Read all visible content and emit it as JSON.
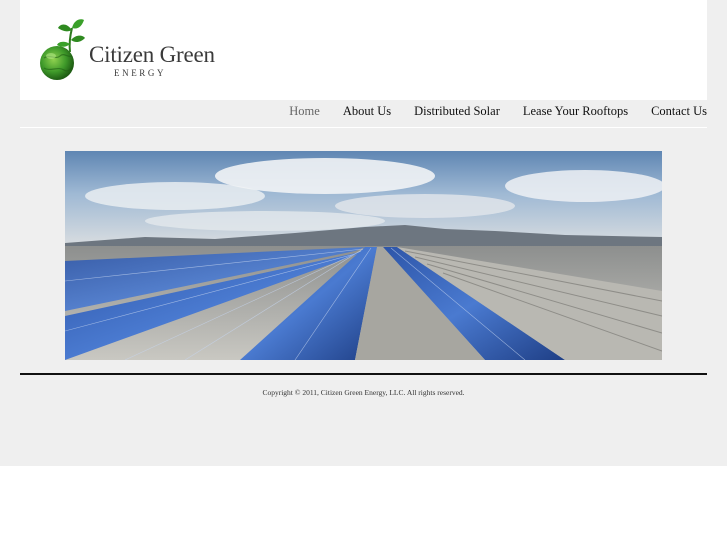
{
  "logo": {
    "name": "Citizen Green",
    "sub": "ENERGY"
  },
  "nav": {
    "items": [
      {
        "label": "Home",
        "active": true
      },
      {
        "label": "About Us",
        "active": false
      },
      {
        "label": "Distributed Solar",
        "active": false
      },
      {
        "label": "Lease Your Rooftops",
        "active": false
      },
      {
        "label": "Contact Us",
        "active": false
      }
    ]
  },
  "banner": {
    "image": "solar-panels-rooftop-photo"
  },
  "footer": {
    "copyright": "Copyright © 2011, Citizen Green Energy, LLC. All rights reserved."
  },
  "colors": {
    "page_bg": "#efefef",
    "header_bg": "#ffffff",
    "accent_green": "#3f9a2a",
    "text_dark": "#111111",
    "nav_active": "#666666"
  }
}
